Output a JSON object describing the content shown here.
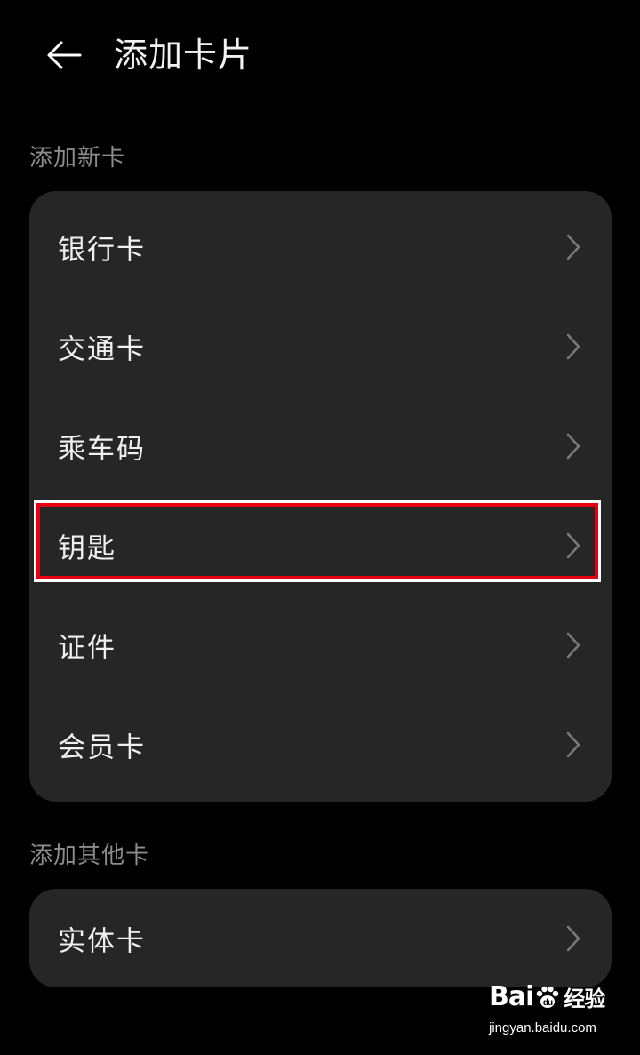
{
  "header": {
    "back_icon": "arrow-left-icon",
    "title": "添加卡片"
  },
  "sections": [
    {
      "label": "添加新卡",
      "items": [
        {
          "label": "银行卡",
          "icon": "chevron-right-icon"
        },
        {
          "label": "交通卡",
          "icon": "chevron-right-icon"
        },
        {
          "label": "乘车码",
          "icon": "chevron-right-icon"
        },
        {
          "label": "钥匙",
          "icon": "chevron-right-icon",
          "highlighted": true
        },
        {
          "label": "证件",
          "icon": "chevron-right-icon"
        },
        {
          "label": "会员卡",
          "icon": "chevron-right-icon"
        }
      ]
    },
    {
      "label": "添加其他卡",
      "items": [
        {
          "label": "实体卡",
          "icon": "chevron-right-icon"
        }
      ]
    }
  ],
  "watermark": {
    "logo_left": "Bai",
    "logo_right": "经验",
    "url": "jingyan.baidu.com"
  },
  "colors": {
    "background": "#000000",
    "card": "#262626",
    "highlight_border": "#e60012",
    "section_label": "#8c8c8c"
  }
}
